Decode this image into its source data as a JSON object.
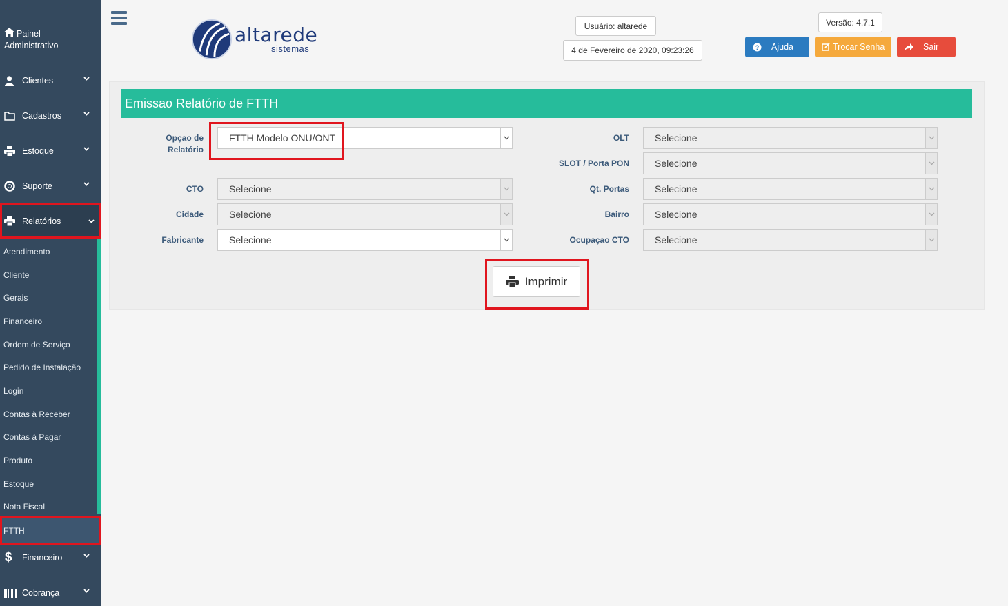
{
  "sidebar": {
    "header": {
      "line1": "Painel",
      "line2": "Administrativo",
      "icon": "home-icon"
    },
    "menu": [
      {
        "label": "Clientes",
        "icon": "user-icon"
      },
      {
        "label": "Cadastros",
        "icon": "folder-icon"
      },
      {
        "label": "Estoque",
        "icon": "print-icon"
      },
      {
        "label": "Suporte",
        "icon": "lifebuoy-icon"
      },
      {
        "label": "Relatórios",
        "icon": "print-icon"
      },
      {
        "label": "Financeiro",
        "icon": "dollar-icon"
      },
      {
        "label": "Cobrança",
        "icon": "barcode-icon"
      }
    ],
    "submenu": [
      "Atendimento",
      "Cliente",
      "Gerais",
      "Financeiro",
      "Ordem de Serviço",
      "Pedido de Instalação",
      "Login",
      "Contas à Receber",
      "Contas à Pagar",
      "Produto",
      "Estoque",
      "Nota Fiscal",
      "FTTH"
    ]
  },
  "header": {
    "logo_main": "altarede",
    "logo_sub": "sistemas",
    "user": "Usuário: altarede",
    "datetime": "4 de Fevereiro de 2020, 09:23:26",
    "version": "Versão: 4.7.1",
    "help_label": "Ajuda",
    "change_password_label": "Trocar Senha",
    "logout_label": "Sair"
  },
  "form": {
    "title": "Emissao Relatório de FTTH",
    "report_option_label_1": "Opçao de",
    "report_option_label_2": "Relatório",
    "report_option_value": "FTTH Modelo ONU/ONT",
    "cto_label": "CTO",
    "cto_value": "Selecione",
    "city_label": "Cidade",
    "city_value": "Selecione",
    "manufacturer_label": "Fabricante",
    "manufacturer_value": "Selecione",
    "olt_label": "OLT",
    "olt_value": "Selecione",
    "slot_label": "SLOT / Porta PON",
    "slot_value": "Selecione",
    "ports_label": "Qt. Portas",
    "ports_value": "Selecione",
    "district_label": "Bairro",
    "district_value": "Selecione",
    "occupation_label": "Ocupaçao CTO",
    "occupation_value": "Selecione",
    "print_label": "Imprimir"
  },
  "colors": {
    "sidebar": "#34495e",
    "accent": "#26bc9b",
    "help": "#2b7bc0",
    "change_password": "#f5a93c",
    "logout": "#e74c3c",
    "highlight": "#e0151e"
  }
}
